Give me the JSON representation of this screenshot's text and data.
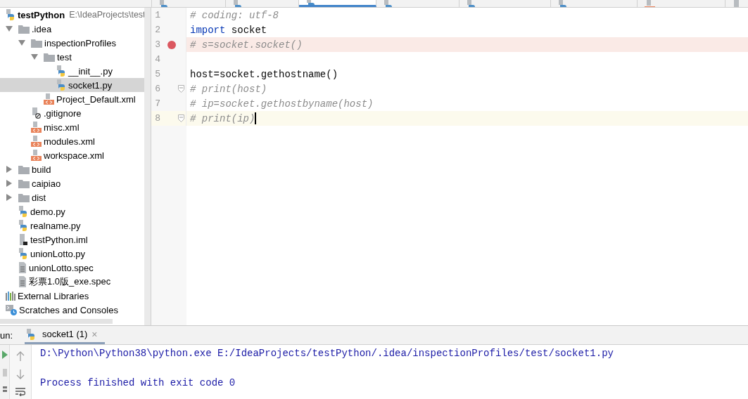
{
  "editor_tabs": [
    {
      "kind": "python",
      "selected": false
    },
    {
      "kind": "python",
      "selected": false
    },
    {
      "kind": "python",
      "selected": true
    },
    {
      "kind": "python",
      "selected": false
    },
    {
      "kind": "python",
      "selected": false
    },
    {
      "kind": "python",
      "selected": false
    },
    {
      "kind": "xml",
      "selected": false
    },
    {
      "kind": "iml",
      "selected": false
    }
  ],
  "project_tree": [
    {
      "label": "testPython",
      "path": "E:\\IdeaProjects\\test",
      "kind": "root",
      "selected": false,
      "children": [
        {
          "label": ".idea",
          "kind": "folder",
          "expanded": true,
          "selected": false,
          "children": [
            {
              "label": "inspectionProfiles",
              "kind": "folder",
              "expanded": true,
              "selected": false,
              "children": [
                {
                  "label": "test",
                  "kind": "folder",
                  "expanded": true,
                  "selected": false,
                  "children": [
                    {
                      "label": "__init__.py",
                      "kind": "python",
                      "selected": false
                    },
                    {
                      "label": "socket1.py",
                      "kind": "python",
                      "selected": true
                    }
                  ]
                },
                {
                  "label": "Project_Default.xml",
                  "kind": "xml",
                  "selected": false
                }
              ]
            },
            {
              "label": ".gitignore",
              "kind": "ignore",
              "selected": false
            },
            {
              "label": "misc.xml",
              "kind": "xml",
              "selected": false
            },
            {
              "label": "modules.xml",
              "kind": "xml",
              "selected": false
            },
            {
              "label": "workspace.xml",
              "kind": "xml",
              "selected": false
            }
          ]
        },
        {
          "label": "build",
          "kind": "folder",
          "expanded": false,
          "selected": false
        },
        {
          "label": "caipiao",
          "kind": "folder",
          "expanded": false,
          "selected": false
        },
        {
          "label": "dist",
          "kind": "folder",
          "expanded": false,
          "selected": false
        },
        {
          "label": "demo.py",
          "kind": "python",
          "selected": false
        },
        {
          "label": "realname.py",
          "kind": "python",
          "selected": false
        },
        {
          "label": "testPython.iml",
          "kind": "iml",
          "selected": false
        },
        {
          "label": "unionLotto.py",
          "kind": "python",
          "selected": false
        },
        {
          "label": "unionLotto.spec",
          "kind": "text",
          "selected": false
        },
        {
          "label": "彩票1.0版_exe.spec",
          "kind": "text",
          "selected": false
        }
      ]
    },
    {
      "label": "External Libraries",
      "kind": "libraries",
      "selected": false
    },
    {
      "label": "Scratches and Consoles",
      "kind": "scratches",
      "selected": false
    }
  ],
  "editor_lines": [
    {
      "number": "1",
      "breakpoint": false,
      "current": false,
      "fold": false,
      "tokens": [
        {
          "text": "# coding: utf-8",
          "kind": "comment"
        }
      ]
    },
    {
      "number": "2",
      "breakpoint": false,
      "current": false,
      "fold": false,
      "tokens": [
        {
          "text": "import",
          "kind": "keyword"
        },
        {
          "text": " socket",
          "kind": "plain"
        }
      ]
    },
    {
      "number": "3",
      "breakpoint": true,
      "current": false,
      "fold": false,
      "tokens": [
        {
          "text": "# s=socket.socket()",
          "kind": "comment"
        }
      ]
    },
    {
      "number": "4",
      "breakpoint": false,
      "current": false,
      "fold": false
    },
    {
      "number": "5",
      "breakpoint": false,
      "current": false,
      "fold": false,
      "tokens": [
        {
          "text": "host=socket.gethostname()",
          "kind": "plain"
        }
      ]
    },
    {
      "number": "6",
      "breakpoint": false,
      "current": false,
      "fold": true,
      "tokens": [
        {
          "text": "# print(host)",
          "kind": "comment"
        }
      ]
    },
    {
      "number": "7",
      "breakpoint": false,
      "current": false,
      "fold": false,
      "tokens": [
        {
          "text": "# ip=socket.gethostbyname(host)",
          "kind": "comment"
        }
      ]
    },
    {
      "number": "8",
      "breakpoint": false,
      "current": true,
      "fold": true,
      "tokens": [
        {
          "text": "# print(ip)",
          "kind": "comment"
        }
      ]
    }
  ],
  "run_panel": {
    "label": "un:",
    "tab": {
      "label": "socket1 (1)",
      "close": "×",
      "selected": true
    },
    "console": [
      "D:\\Python\\Python38\\python.exe E:/IdeaProjects/testPython/.idea/inspectionProfiles/test/socket1.py",
      "Process finished with exit code 0"
    ]
  }
}
